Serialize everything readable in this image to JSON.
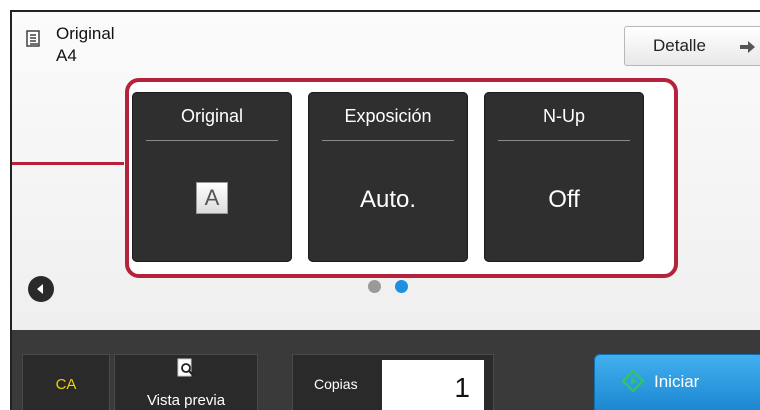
{
  "header": {
    "original_title": "Original",
    "original_size": "A4",
    "detail_button": "Detalle"
  },
  "tiles": [
    {
      "label": "Original",
      "value_icon": "A"
    },
    {
      "label": "Exposición",
      "value": "Auto."
    },
    {
      "label": "N-Up",
      "value": "Off"
    }
  ],
  "pager": {
    "pages": 2,
    "active_page": 2
  },
  "bottombar": {
    "clear_all": "CA",
    "preview": "Vista previa",
    "copies_label": "Copias",
    "copies_value": "1",
    "start": "Iniciar"
  },
  "colors": {
    "highlight": "#b6213b",
    "tile_bg": "#2f2f2f",
    "start_button": "#2a96de",
    "ca_text": "#f2d000",
    "dot_inactive": "#9a9a9a",
    "dot_active": "#1f8fdf",
    "start_icon": "#2fc46a"
  },
  "icons": {
    "original": "document-list-icon",
    "detalle": "arrow-right-icon",
    "nav_left": "chevron-left-icon",
    "preview": "magnifier-page-icon",
    "start": "start-diamond-icon"
  }
}
